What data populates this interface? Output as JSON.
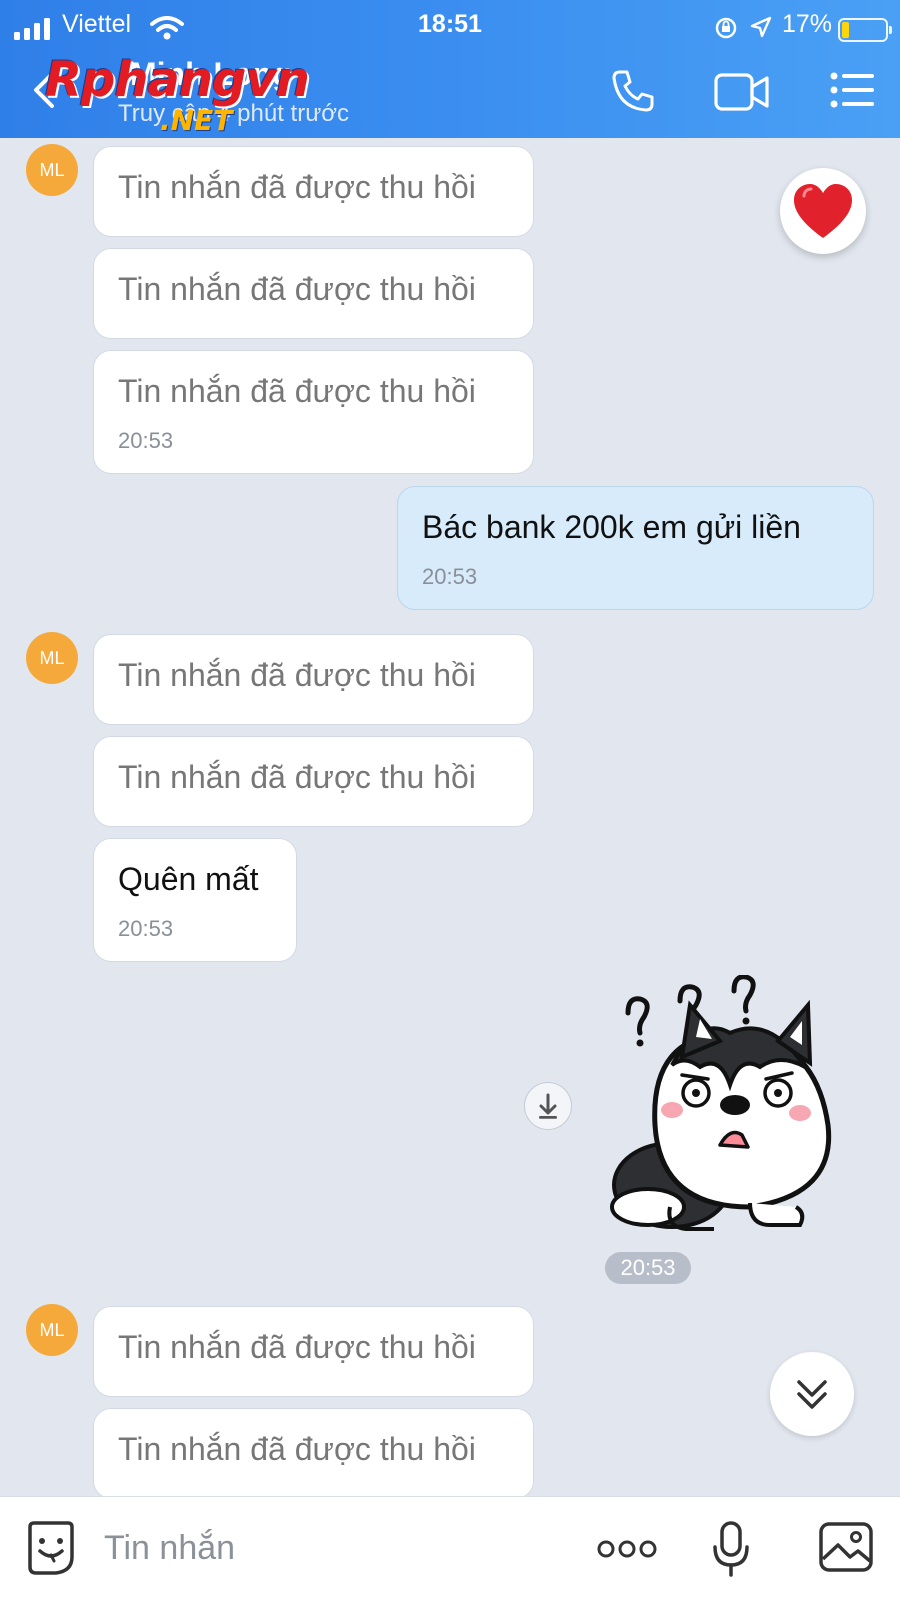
{
  "status_bar": {
    "carrier": "Viettel",
    "time": "18:51",
    "battery": "17%",
    "battery_level": 0.17
  },
  "header": {
    "title": "Minh Long",
    "subtitle": "Truy cập 4 phút trước",
    "watermark_main": "Rphangvn",
    "watermark_sub": ".NET",
    "icons": [
      "back-chevron-icon",
      "phone-icon",
      "video-call-icon",
      "menu-list-icon"
    ]
  },
  "avatar": {
    "initials": "ML"
  },
  "messages": [
    {
      "text": "Tin nhắn đã được thu hồi",
      "time": ""
    },
    {
      "text": "Tin nhắn đã được thu hồi",
      "time": ""
    },
    {
      "text": "Tin nhắn đã được thu hồi",
      "time": "20:53"
    },
    {
      "text": "Bác bank 200k em gửi liền",
      "time": "20:53"
    },
    {
      "text": "Tin nhắn đã được thu hồi",
      "time": ""
    },
    {
      "text": "Tin nhắn đã được thu hồi",
      "time": ""
    },
    {
      "text": "Quên mất",
      "time": "20:53"
    },
    {
      "text": "",
      "time": "20:53"
    },
    {
      "text": "Tin nhắn đã được thu hồi",
      "time": ""
    },
    {
      "text": "Tin nhắn đã được thu hồi",
      "time": ""
    }
  ],
  "composer": {
    "placeholder": "Tin nhắn",
    "icons": [
      "sticker-icon",
      "more-icon",
      "microphone-icon",
      "image-icon"
    ]
  },
  "colors": {
    "header_blue": "#3b8ef0",
    "avatar_orange": "#f5a93a",
    "my_bubble": "#d7ebfb",
    "chat_background": "#e2e7ef"
  }
}
